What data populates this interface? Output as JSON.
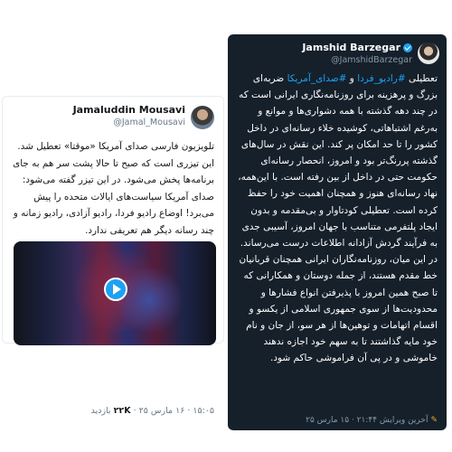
{
  "left_tweet": {
    "name": "Jamaluddin Mousavi",
    "handle": "@Jamal_Mousavi",
    "text": "تلویزیون فارسی صدای آمریکا «موقتا» تعطیل شد. این تیزری است که صبح تا حالا پشت سر هم به جای برنامه‌ها پخش می‌شود. در این تیزر گفته می‌شود: صدای آمریکا سیاست‌های ایالات متحده را پیش می‌برد! اوضاع رادیو فردا، رادیو آزادی، رادیو زمانه و چند رسانه دیگر هم تعریفی ندارد.",
    "time": "۱۵:۰۵ · ۱۶ مارس ۲۵",
    "views_count": "۲۲K",
    "views_label": "بازدید"
  },
  "right_tweet": {
    "name": "Jamshid Barzegar",
    "handle": "@JamshidBarzegar",
    "body_intro": "تعطیلی ",
    "tag1": "#رادیو_فردا",
    "connector": " و ",
    "tag2": "#صدای_آمریکا",
    "body_rest": " ضربه‌ای بزرگ و پرهزینه برای روزنامه‌نگاری ایرانی است که در چند دهه گذشته با همه دشواری‌ها و موانع و به‌رغم اشتباهاتی، کوشیده خلاء رسانه‌ای در داخل کشور را تا حد امکان پر کند. این نقش در سال‌های گذشته پررنگ‌تر بود و امروز، انحصار رسانه‌ای حکومت حتی در داخل از بین رفته است. با این‌همه، نهاد رسانه‌ای هنوز و همچنان اهمیت خود را حفظ کرده است. تعطیلی کودتاوار و بی‌مقدمه و بدون ایجاد پلتفرمی متناسب با جهان امروز، آسیبی جدی به فرآیند گردش آزادانه اطلاعات درست می‌رساند.",
    "body_para2": "در این میان، روزنامه‌نگاران ایرانی همچنان قربانیان خط مقدم هستند، از جمله دوستان و همکارانی که تا صبح همین امروز با پذیرفتن انواع فشارها و محدودیت‌ها از سوی جمهوری اسلامی از یکسو و اقسام اتهامات و توهین‌ها از هر سو، از جان و نام خود مایه گذاشتند تا به سهم خود اجازه ندهند خاموشی و در پی آن فراموشی حاکم شود.",
    "edited_label": "آخرین ویرایش ۲۱:۴۴ · ۱۵ مارس ۲۵"
  },
  "colors": {
    "dark_card_bg": "#15202b",
    "accent_blue": "#1da1f2",
    "muted_gray": "#657786"
  }
}
